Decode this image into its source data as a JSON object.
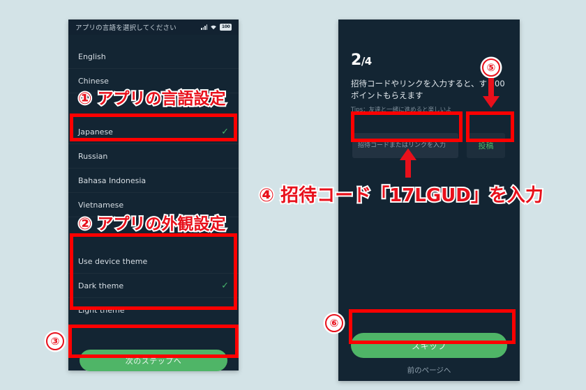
{
  "meta": {
    "background_color": "#d3e3e7",
    "phone_bg": "#132533",
    "accent_green": "#4fb567",
    "annotation_red": "#e8101b"
  },
  "left_phone": {
    "statusbar": {
      "title": "アプリの言語を選択してください",
      "signal_icon": "signal-bars-icon",
      "wifi_icon": "wifi-icon",
      "battery_level": "100"
    },
    "language_list": [
      {
        "label": "English",
        "selected": false
      },
      {
        "label": "Chinese",
        "selected": false
      },
      {
        "label": "Japanese",
        "selected": true
      },
      {
        "label": "Russian",
        "selected": false
      },
      {
        "label": "Bahasa Indonesia",
        "selected": false
      },
      {
        "label": "Vietnamese",
        "selected": false
      }
    ],
    "theme_list": [
      {
        "label": "Use device theme",
        "selected": false
      },
      {
        "label": "Dark theme",
        "selected": true
      },
      {
        "label": "Light theme",
        "selected": false
      }
    ],
    "next_step_button": "次のステップへ",
    "check_glyph": "✓"
  },
  "right_phone": {
    "step_number": "2",
    "step_separator": "/4",
    "promo_text": "招待コードやリンクを入力すると、す 100ポイントもらえます",
    "tips_text": "Tips：友達と一緒に進めると楽しいよ",
    "invite_input_placeholder": "招待コードまたはリンクを入力",
    "invite_input_value": "",
    "submit_button": "投稿",
    "skip_button": "スキップ",
    "prev_page_link": "前のページへ"
  },
  "annotations": {
    "step1_label": "① アプリの言語設定",
    "step2_label": "② アプリの外観設定",
    "step3_marker": "③",
    "step4_label": "④ 招待コード「17LGUD」を入力",
    "step5_marker": "⑤",
    "step6_marker": "⑥"
  }
}
